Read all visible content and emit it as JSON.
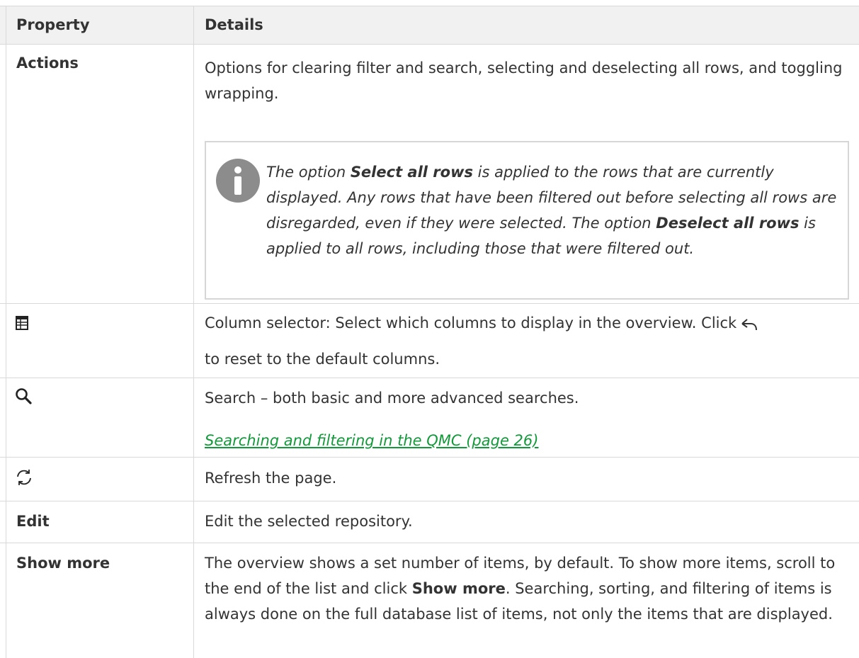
{
  "table": {
    "header": {
      "property": "Property",
      "details": "Details"
    },
    "rows": [
      {
        "property": "Actions",
        "details": "Options for clearing filter and search, selecting and deselecting all rows, and toggling wrapping.",
        "note": {
          "icon": "info-icon",
          "part1": "The option ",
          "bold1": "Select all rows",
          "part2": " is applied to the rows that are currently displayed. Any rows that have been filtered out before selecting all rows are disregarded, even if they were selected. The option ",
          "bold2": "Deselect all rows",
          "part3": " is applied to all rows, including those that were filtered out."
        }
      },
      {
        "property_icon": "table-columns-icon",
        "details_part1": "Column selector: Select which columns to display in the overview. Click",
        "inline_icon": "undo-arrow-icon",
        "details_part2": "to reset to the default columns."
      },
      {
        "property_icon": "search-icon",
        "details": "Search – both basic and more advanced searches.",
        "link": " Searching and filtering in the QMC (page 26)"
      },
      {
        "property_icon": "refresh-icon",
        "details": "Refresh the page."
      },
      {
        "property": "Edit",
        "details": "Edit the selected repository."
      },
      {
        "property": "Show more",
        "details_part1": "The overview shows a set number of items, by default. To show more items, scroll to the end of the list and click ",
        "details_bold": "Show more",
        "details_part2": ". Searching, sorting, and filtering of items is always done on the full database list of items, not only the items that are displayed."
      }
    ]
  },
  "colors": {
    "border": "#d9d9d9",
    "header_bg": "#f1f1f1",
    "link": "#129a3a",
    "icon": "#8c8c8c"
  }
}
